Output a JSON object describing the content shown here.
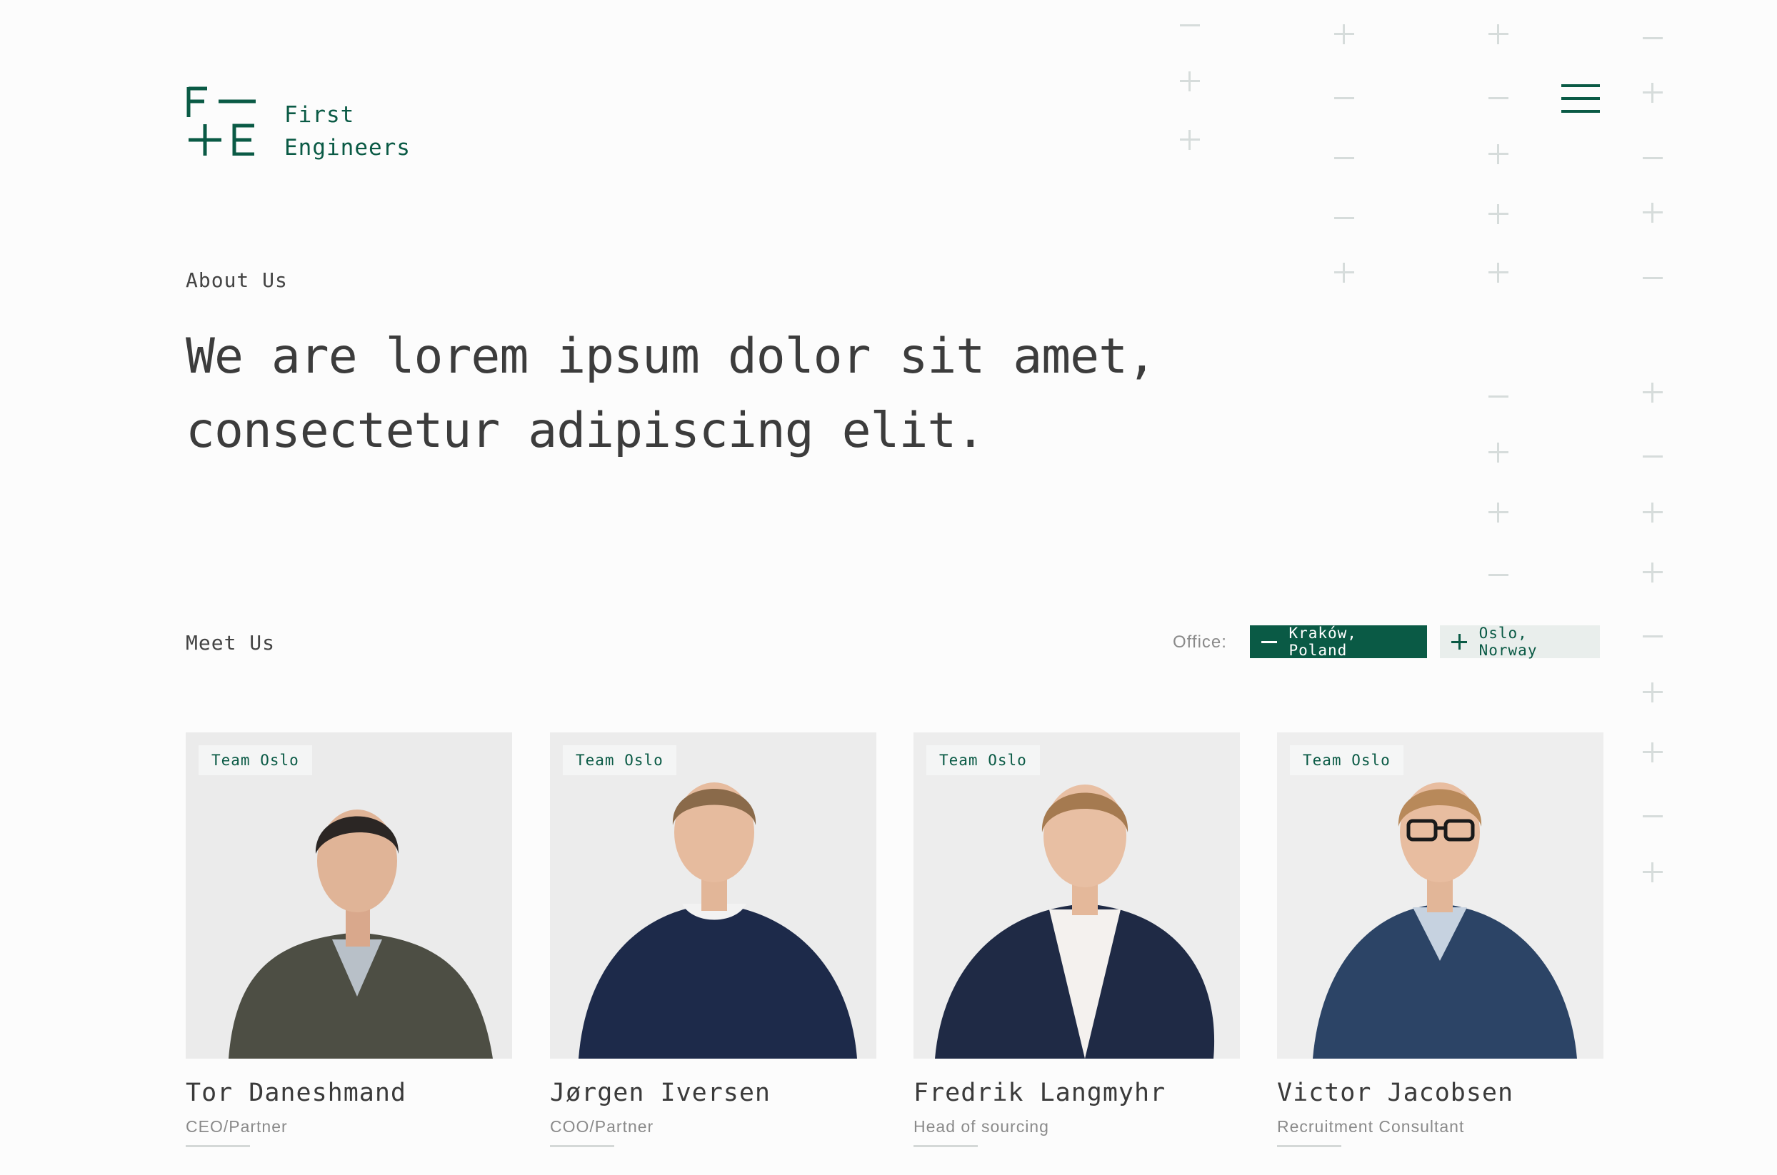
{
  "brand": {
    "name_line1": "First",
    "name_line2": "Engineers",
    "accent_color": "#0a5a45"
  },
  "header": {
    "menu_icon": "hamburger-icon"
  },
  "about": {
    "eyebrow": "About Us",
    "headline": "We are lorem ipsum dolor sit amet, consectetur adipiscing elit."
  },
  "meet": {
    "eyebrow": "Meet Us",
    "office_label": "Office:",
    "offices": [
      {
        "label": "Kraków, Poland",
        "icon": "minus-icon",
        "active": true
      },
      {
        "label": "Oslo, Norway",
        "icon": "plus-icon",
        "active": false
      }
    ]
  },
  "team": [
    {
      "badge": "Team Oslo",
      "name": "Tor Daneshmand",
      "role": "CEO/Partner"
    },
    {
      "badge": "Team Oslo",
      "name": "Jørgen Iversen",
      "role": "COO/Partner"
    },
    {
      "badge": "Team Oslo",
      "name": "Fredrik Langmyhr",
      "role": "Head of sourcing"
    },
    {
      "badge": "Team Oslo",
      "name": "Victor Jacobsen",
      "role": "Recruitment Consultant"
    }
  ]
}
